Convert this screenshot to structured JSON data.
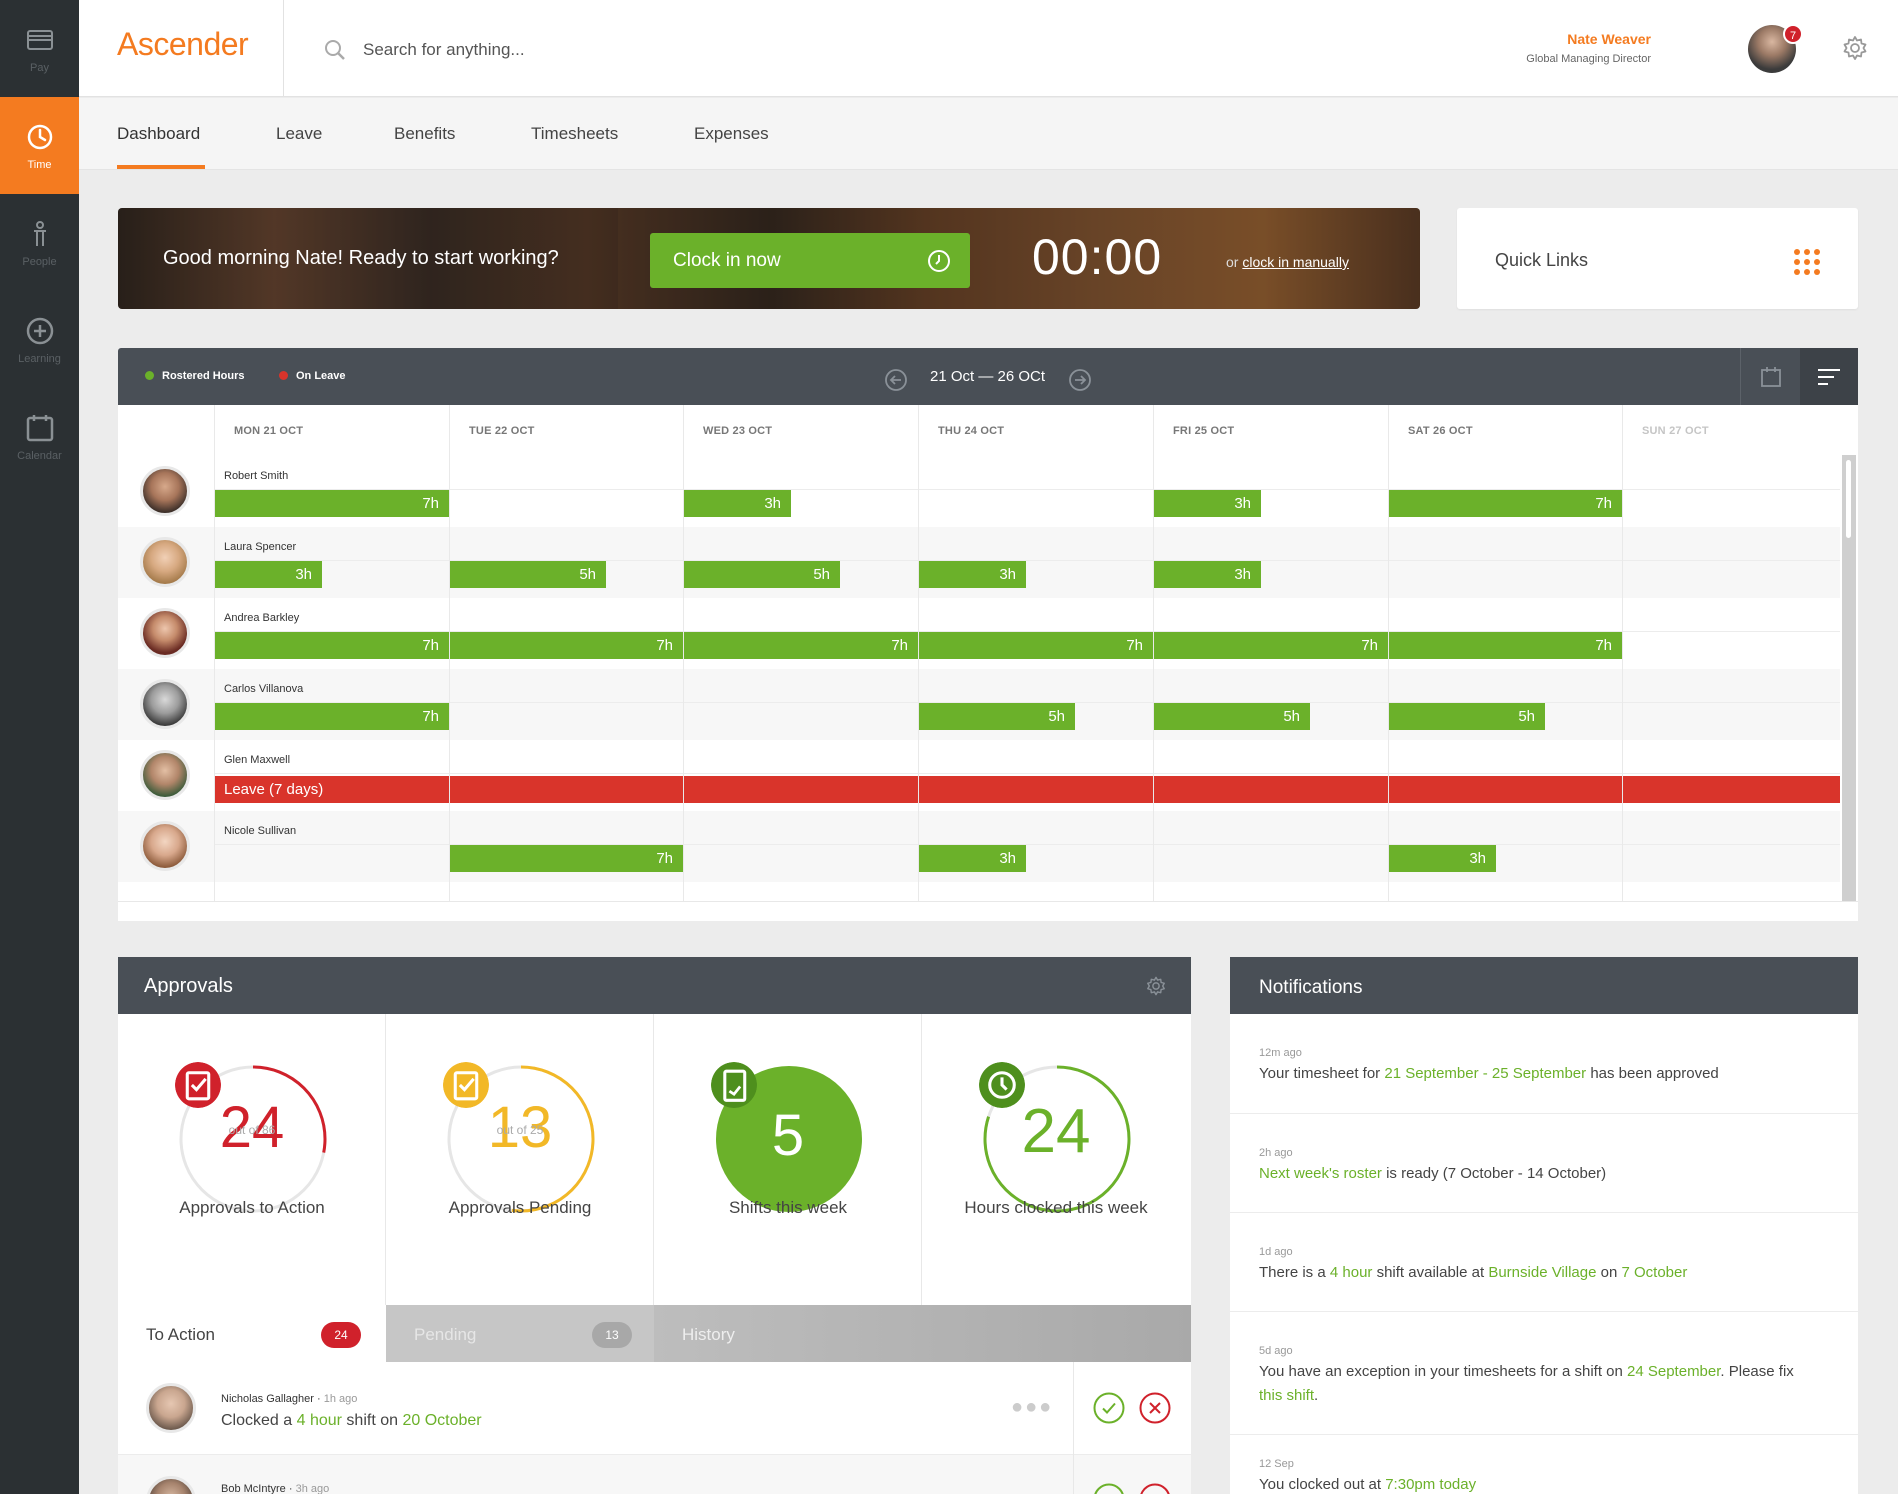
{
  "sidebar": {
    "items": [
      {
        "label": "Pay",
        "icon": "wallet-icon"
      },
      {
        "label": "Time",
        "icon": "clock-icon",
        "active": true
      },
      {
        "label": "People",
        "icon": "person-icon"
      },
      {
        "label": "Learning",
        "icon": "plus-circle-icon"
      },
      {
        "label": "Calendar",
        "icon": "calendar-icon"
      }
    ]
  },
  "header": {
    "logo": "Ascender",
    "search_placeholder": "Search for anything...",
    "user_name": "Nate Weaver",
    "user_role": "Global Managing Director",
    "notification_count": "7"
  },
  "tabs": [
    "Dashboard",
    "Leave",
    "Benefits",
    "Timesheets",
    "Expenses"
  ],
  "hero": {
    "greeting": "Good morning Nate! Ready to start working?",
    "clock_in_label": "Clock in now",
    "timer": "00:00",
    "manual_prefix": "or",
    "manual_link": "clock in manually"
  },
  "quick_links": {
    "title": "Quick Links"
  },
  "roster": {
    "legend": [
      {
        "label": "Rostered Hours",
        "color": "#6bb12a"
      },
      {
        "label": "On Leave",
        "color": "#d9342b"
      }
    ],
    "range": "21 Oct — 26 OCt",
    "days": [
      "MON 21 OCT",
      "TUE 22 OCT",
      "WED 23 OCT",
      "THU 24 OCT",
      "FRI 25 OCT",
      "SAT 26 OCT",
      "SUN 27 OCT"
    ],
    "people": [
      {
        "name": "Robert Smith",
        "shifts": [
          {
            "day": 0,
            "hours": "7h",
            "full": true
          },
          {
            "day": 2,
            "hours": "3h"
          },
          {
            "day": 4,
            "hours": "3h"
          },
          {
            "day": 5,
            "hours": "7h",
            "full": true
          }
        ]
      },
      {
        "name": "Laura Spencer",
        "shifts": [
          {
            "day": 0,
            "hours": "3h"
          },
          {
            "day": 1,
            "hours": "5h"
          },
          {
            "day": 2,
            "hours": "5h"
          },
          {
            "day": 3,
            "hours": "3h"
          },
          {
            "day": 4,
            "hours": "3h"
          }
        ]
      },
      {
        "name": "Andrea Barkley",
        "shifts": [
          {
            "day": 0,
            "hours": "7h",
            "full": true
          },
          {
            "day": 1,
            "hours": "7h",
            "full": true
          },
          {
            "day": 2,
            "hours": "7h",
            "full": true
          },
          {
            "day": 3,
            "hours": "7h",
            "full": true
          },
          {
            "day": 4,
            "hours": "7h",
            "full": true
          },
          {
            "day": 5,
            "hours": "7h",
            "full": true
          }
        ]
      },
      {
        "name": "Carlos Villanova",
        "shifts": [
          {
            "day": 0,
            "hours": "7h",
            "full": true
          },
          {
            "day": 3,
            "hours": "5h"
          },
          {
            "day": 4,
            "hours": "5h"
          },
          {
            "day": 5,
            "hours": "5h"
          }
        ]
      },
      {
        "name": "Glen Maxwell",
        "leave": "Leave (7 days)"
      },
      {
        "name": "Nicole Sullivan",
        "shifts": [
          {
            "day": 1,
            "hours": "7h",
            "full": true
          },
          {
            "day": 3,
            "hours": "3h"
          },
          {
            "day": 5,
            "hours": "3h"
          }
        ]
      }
    ]
  },
  "approvals": {
    "title": "Approvals",
    "stats": [
      {
        "value": "24",
        "sub": "out of 86",
        "label": "Approvals to Action",
        "fraction": 0.28,
        "color": "#d0212b"
      },
      {
        "value": "13",
        "sub": "out of 25",
        "label": "Approvals Pending",
        "fraction": 0.52,
        "color": "#f2b827"
      },
      {
        "value": "5",
        "sub": "",
        "label": "Shifts this week",
        "fraction": 1.0,
        "color": "#6bb12a"
      },
      {
        "value": "24",
        "sub": "",
        "label": "Hours clocked this week",
        "fraction": 0.8,
        "color": "#6bb12a"
      }
    ],
    "tabs": [
      {
        "label": "To Action",
        "count": "24"
      },
      {
        "label": "Pending",
        "count": "13"
      },
      {
        "label": "History"
      }
    ],
    "items": [
      {
        "name": "Nicholas Gallagher",
        "time": "1h ago",
        "pre": "Clocked a ",
        "hl1": "4 hour",
        "mid": " shift on ",
        "hl2": "20 October"
      },
      {
        "name": "Bob McIntyre",
        "time": "3h ago"
      }
    ]
  },
  "notifications": {
    "title": "Notifications",
    "items": [
      {
        "time": "12m ago",
        "parts": [
          [
            "Your timesheet for ",
            false
          ],
          [
            "21 September - 25 September",
            true
          ],
          [
            " has been approved",
            false
          ]
        ]
      },
      {
        "time": "2h ago",
        "parts": [
          [
            "Next week's roster",
            true
          ],
          [
            " is ready (7 October - 14 October)",
            false
          ]
        ]
      },
      {
        "time": "1d ago",
        "parts": [
          [
            "There is a ",
            false
          ],
          [
            "4 hour",
            true
          ],
          [
            " shift available at ",
            false
          ],
          [
            "Burnside Village",
            true
          ],
          [
            " on ",
            false
          ],
          [
            "7 October",
            true
          ]
        ]
      },
      {
        "time": "5d ago",
        "parts": [
          [
            "You have an exception in your timesheets for a shift on ",
            false
          ],
          [
            "24 September",
            true
          ],
          [
            ". Please fix ",
            false
          ],
          [
            "this shift",
            true
          ],
          [
            ".",
            false
          ]
        ]
      },
      {
        "time": "12 Sep",
        "parts": [
          [
            "You clocked out at ",
            false
          ],
          [
            "7:30pm today",
            true
          ]
        ]
      }
    ]
  }
}
